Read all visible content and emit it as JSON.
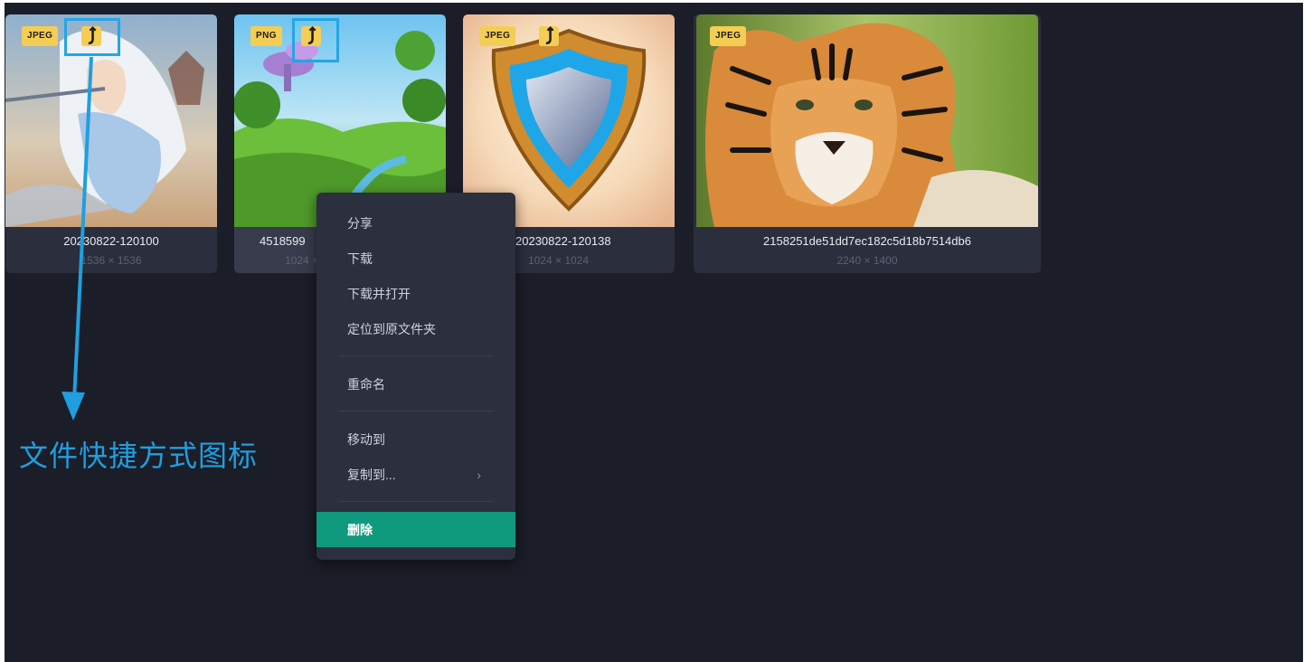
{
  "cards": [
    {
      "type_badge": "JPEG",
      "filename": "20230822-120100",
      "dims": "1536 × 1536",
      "shortcut_icon": "shortcut-arrow-icon",
      "thumb_subject": "anime-warrior"
    },
    {
      "type_badge": "PNG",
      "filename": "4518599",
      "dims": "1024 × 1024",
      "shortcut_icon": "shortcut-arrow-icon",
      "thumb_subject": "fantasy-landscape"
    },
    {
      "type_badge": "JPEG",
      "filename": "20230822-120138",
      "dims": "1024 × 1024",
      "shortcut_icon": "shortcut-arrow-icon",
      "thumb_subject": "shield"
    },
    {
      "type_badge": "JPEG",
      "filename": "2158251de51dd7ec182c5d18b7514db6",
      "dims": "2240 × 1400",
      "thumb_subject": "tiger"
    }
  ],
  "context_menu": {
    "items": [
      {
        "label": "分享"
      },
      {
        "label": "下载"
      },
      {
        "label": "下载并打开"
      },
      {
        "label": "定位到原文件夹"
      },
      {
        "label": "重命名"
      },
      {
        "label": "移动到"
      },
      {
        "label": "复制到...",
        "chevron": "›"
      },
      {
        "label": "删除"
      }
    ]
  },
  "annotation": {
    "label": "文件快捷方式图标"
  },
  "colors": {
    "background": "#1b1d28",
    "card": "#2b2e3c",
    "badge": "#f4cd55",
    "highlight": "#23a6e6",
    "delete": "#0f9a7e"
  }
}
